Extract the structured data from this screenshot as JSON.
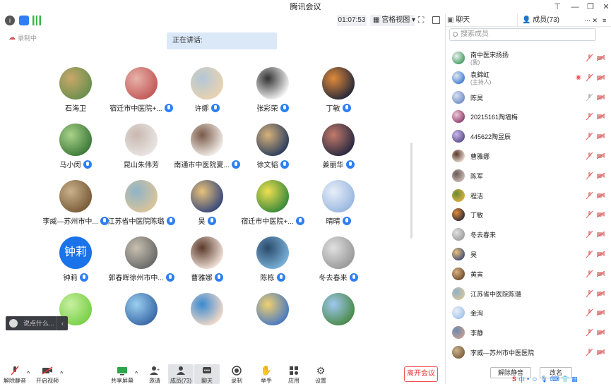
{
  "window": {
    "title": "腾讯会议"
  },
  "toolbar": {
    "time": "01:07:53",
    "view": "宫格视图"
  },
  "recording": {
    "label": "录制中"
  },
  "speaking": {
    "label": "正在讲话:"
  },
  "grid": [
    {
      "name": "石海卫",
      "mic": false,
      "c1": "#6b8f4e",
      "c2": "#c9a86a"
    },
    {
      "name": "宿迁市中医院+...",
      "mic": true,
      "c1": "#c45a5a",
      "c2": "#e6b3a8"
    },
    {
      "name": "许娜",
      "mic": true,
      "c1": "#e8d2b0",
      "c2": "#b3c7d8"
    },
    {
      "name": "张彩荣",
      "mic": true,
      "c1": "#f3f3f3",
      "c2": "#333333"
    },
    {
      "name": "丁敏",
      "mic": true,
      "c1": "#2a2a38",
      "c2": "#e08a3a"
    },
    {
      "name": "马小闵",
      "mic": true,
      "c1": "#3f7a3a",
      "c2": "#a9d38a"
    },
    {
      "name": "昆山朱伟芳",
      "mic": false,
      "c1": "#e9e4e2",
      "c2": "#c8b8b0"
    },
    {
      "name": "南通市中医院夏...",
      "mic": true,
      "c1": "#f2ece6",
      "c2": "#7a5a4a"
    },
    {
      "name": "徐文韬",
      "mic": true,
      "c1": "#2d3f5e",
      "c2": "#d8b27a"
    },
    {
      "name": "姜丽华",
      "mic": true,
      "c1": "#2a2a40",
      "c2": "#c47a6a"
    },
    {
      "name": "李威—苏州市中...",
      "mic": true,
      "c1": "#7a5c3a",
      "c2": "#c9b28a"
    },
    {
      "name": "江苏省中医院陈璐",
      "mic": true,
      "c1": "#d9c49a",
      "c2": "#8fb3c8"
    },
    {
      "name": "昊",
      "mic": true,
      "c1": "#3a4a7a",
      "c2": "#e8c27a"
    },
    {
      "name": "宿迁市中医院+...",
      "mic": true,
      "c1": "#3a8a3a",
      "c2": "#f0e050"
    },
    {
      "name": "晴晴",
      "mic": true,
      "c1": "#9ab8e0",
      "c2": "#e8eef8"
    },
    {
      "name": "钟莉",
      "mic": true,
      "text": "钟莉"
    },
    {
      "name": "郭春晖徐州市中...",
      "mic": true,
      "c1": "#6a6a6a",
      "c2": "#c8c0b0"
    },
    {
      "name": "曹雅娜",
      "mic": true,
      "c1": "#f0e0d8",
      "c2": "#5a3a2a"
    },
    {
      "name": "陈栋",
      "mic": true,
      "c1": "#7ab0d8",
      "c2": "#2a4a6a"
    },
    {
      "name": "冬去春来",
      "mic": true,
      "c1": "#9a9a9a",
      "c2": "#e0e0e0"
    },
    {
      "name": "",
      "mic": false,
      "c1": "#7ad04a",
      "c2": "#c8f0a0"
    },
    {
      "name": "",
      "mic": false,
      "c1": "#3a6aa8",
      "c2": "#9ad0f0"
    },
    {
      "name": "",
      "mic": false,
      "c1": "#f0d8c8",
      "c2": "#3a8ad0"
    },
    {
      "name": "",
      "mic": false,
      "c1": "#4a7ac0",
      "c2": "#f0d070"
    },
    {
      "name": "",
      "mic": false,
      "c1": "#4a8a4a",
      "c2": "#a0c8f0"
    }
  ],
  "chat": {
    "placeholder": "说点什么..."
  },
  "bottom": {
    "unmute": "解除静音",
    "video": "开启视频",
    "share": "共享屏幕",
    "invite": "邀请",
    "members": "成员(73)",
    "chat": "聊天",
    "record": "录制",
    "hand": "举手",
    "apps": "应用",
    "settings": "设置",
    "leave": "离开会议"
  },
  "panel": {
    "tab_chat": "聊天",
    "tab_members": "成员(73)",
    "search_placeholder": "搜索成员",
    "members": [
      {
        "name": "南中医宋扬扬",
        "sub": "(我)",
        "c1": "#3a9a5a",
        "c2": "#f0f0f0"
      },
      {
        "name": "袁錦虹",
        "sub": "(主持人)",
        "c1": "#3a7ad0",
        "c2": "#e0e8f0"
      },
      {
        "name": "陈昊",
        "sub": "",
        "c1": "#6a8ac8",
        "c2": "#d8e0f0"
      },
      {
        "name": "20215161陶墙梅",
        "sub": "",
        "c1": "#8a3a6a",
        "c2": "#f0c8d8"
      },
      {
        "name": "445622陶昱辰",
        "sub": "",
        "c1": "#5a4a8a",
        "c2": "#c8b8e8"
      },
      {
        "name": "曹雅娜",
        "sub": "",
        "c1": "#f0e0d8",
        "c2": "#5a3a2a"
      },
      {
        "name": "陈军",
        "sub": "",
        "c1": "#d0c0b8",
        "c2": "#6a5a5a"
      },
      {
        "name": "程洁",
        "sub": "",
        "c1": "#e0b040",
        "c2": "#6a8a3a"
      },
      {
        "name": "丁敏",
        "sub": "",
        "c1": "#2a2a38",
        "c2": "#e08a3a"
      },
      {
        "name": "冬去春来",
        "sub": "",
        "c1": "#9a9a9a",
        "c2": "#e0e0e0"
      },
      {
        "name": "昊",
        "sub": "",
        "c1": "#3a4a7a",
        "c2": "#e8c27a"
      },
      {
        "name": "黄寅",
        "sub": "",
        "c1": "#6a4a2a",
        "c2": "#d8b080"
      },
      {
        "name": "江苏省中医院陈璐",
        "sub": "",
        "c1": "#d9c49a",
        "c2": "#8fb3c8"
      },
      {
        "name": "金洵",
        "sub": "",
        "c1": "#a0c0e8",
        "c2": "#e8f0f8"
      },
      {
        "name": "李静",
        "sub": "",
        "c1": "#c8a090",
        "c2": "#6a8ab0"
      },
      {
        "name": "李威—苏州市中医医院",
        "sub": "",
        "c1": "#7a5c3a",
        "c2": "#c9b28a"
      }
    ],
    "unmute_all": "解除静音",
    "rename": "改名"
  }
}
